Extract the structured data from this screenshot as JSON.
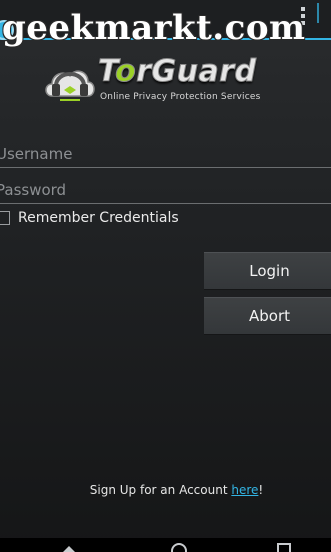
{
  "watermark": {
    "text": "geekmarkt.com"
  },
  "logo": {
    "brand_part1": "T",
    "brand_accent": "o",
    "brand_part2": "rGuard",
    "tagline": "Online Privacy Protection Services"
  },
  "form": {
    "username_placeholder": "Username",
    "username_value": "",
    "password_placeholder": "Password",
    "password_value": "",
    "remember_label": "Remember Credentials",
    "remember_checked": false
  },
  "buttons": {
    "login_label": "Login",
    "abort_label": "Abort"
  },
  "signup": {
    "prefix": "Sign Up for an Account ",
    "link_text": "here",
    "suffix": "!"
  },
  "colors": {
    "accent": "#33b5e5",
    "logo_green": "#9bd127",
    "background": "#202224"
  },
  "icons": {
    "app": "app-icon",
    "overflow": "overflow-menu-icon",
    "back": "back-icon",
    "home": "home-icon",
    "recents": "recents-icon",
    "logo": "cloud-headphones-logo-icon"
  }
}
